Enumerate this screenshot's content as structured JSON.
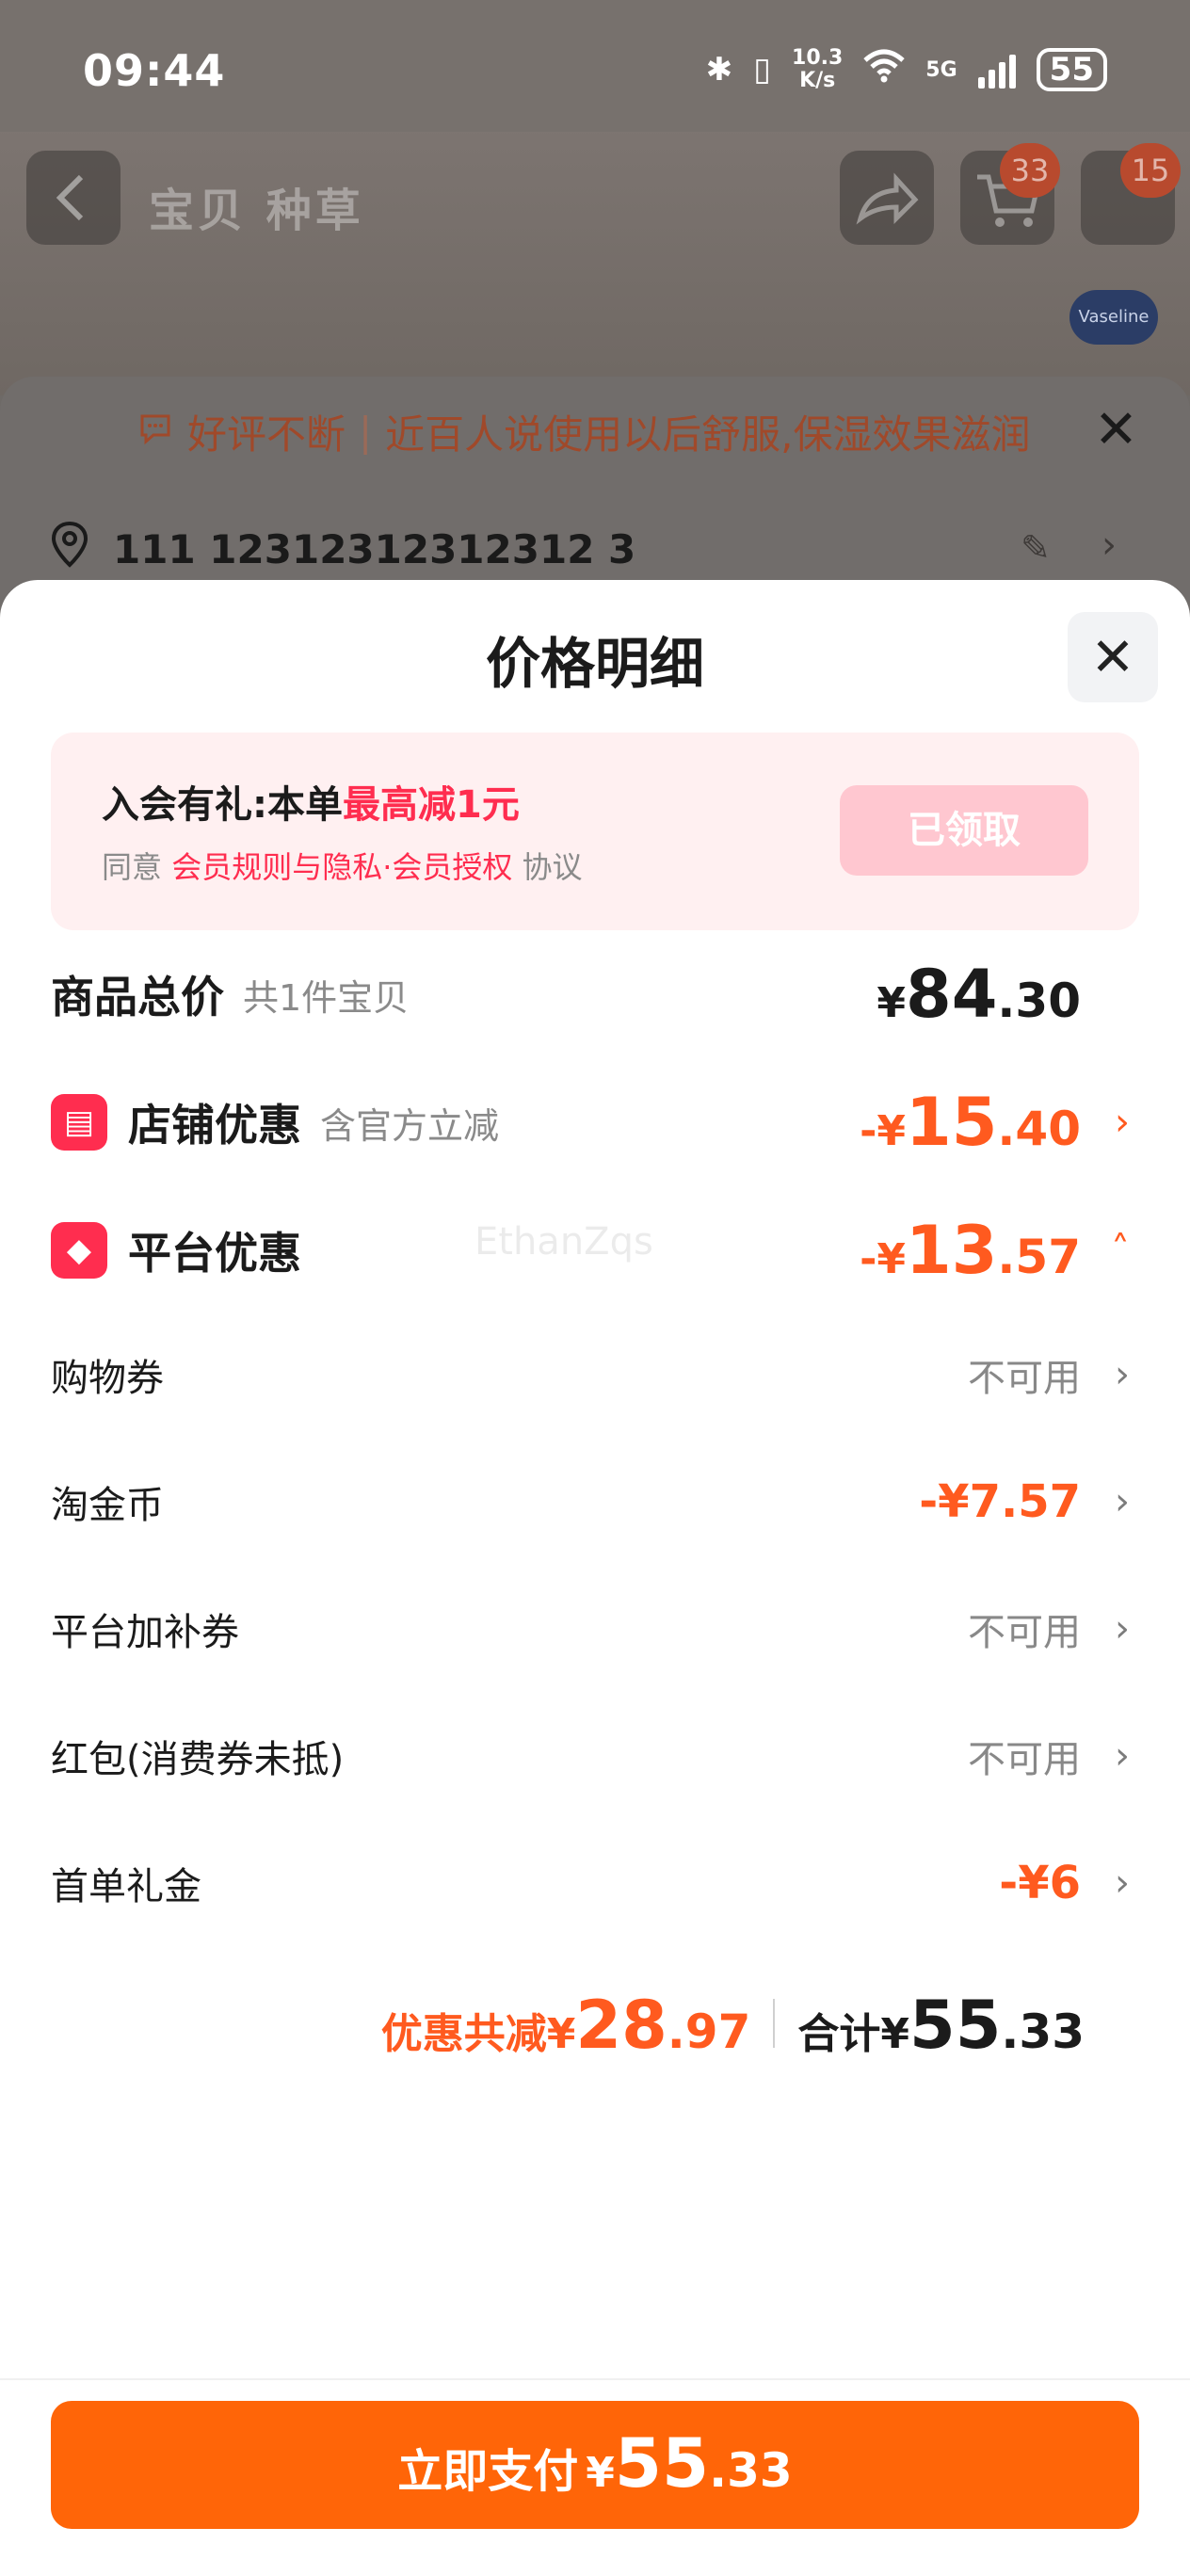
{
  "status_bar": {
    "time": "09:44",
    "net_speed": "10.3",
    "net_unit": "K/s",
    "network": "5G",
    "battery": "55"
  },
  "background": {
    "tabs": "宝贝  种草",
    "cart_badge": "33",
    "more_badge": "15",
    "brand": "Vaseline",
    "tip_prefix": "好评不断",
    "tip_text": "近百人说使用以后舒服,保湿效果滋润",
    "address": "111 12312312312312 3"
  },
  "sheet": {
    "title": "价格明细",
    "member": {
      "lead": "入会有礼:本单",
      "highlight": "最高减1元",
      "agree": "同意",
      "rules": "会员规则与隐私·会员授权",
      "suffix": "协议",
      "button": "已领取"
    },
    "rows": {
      "total": {
        "name": "商品总价",
        "sub": "共1件宝贝",
        "cur": "¥",
        "int": "84",
        "dec": ".30"
      },
      "store": {
        "name": "店铺优惠",
        "sub": "含官方立减",
        "cur": "-¥",
        "int": "15",
        "dec": ".40"
      },
      "platform": {
        "name": "平台优惠",
        "cur": "-¥",
        "int": "13",
        "dec": ".57"
      },
      "shopping_coupon": {
        "name": "购物券",
        "value": "不可用"
      },
      "taojinbi": {
        "name": "淘金币",
        "value": "-¥7.57"
      },
      "platform_extra": {
        "name": "平台加补券",
        "value": "不可用"
      },
      "red_packet": {
        "name": "红包(消费券未抵)",
        "value": "不可用"
      },
      "first_order": {
        "name": "首单礼金",
        "value": "-¥6"
      }
    },
    "watermark": "EthanZqs",
    "summary": {
      "discount_label": "优惠共减¥",
      "discount_int": "28",
      "discount_dec": ".97",
      "total_label": "合计¥",
      "total_int": "55",
      "total_dec": ".33"
    },
    "pay_button": {
      "label": "立即支付",
      "cur": "¥",
      "int": "55",
      "dec": ".33"
    }
  },
  "colors": {
    "accent": "#ff6508",
    "discount": "#ff5a1f",
    "member_red": "#ff2d4f",
    "member_bg": "#fff0f1"
  }
}
